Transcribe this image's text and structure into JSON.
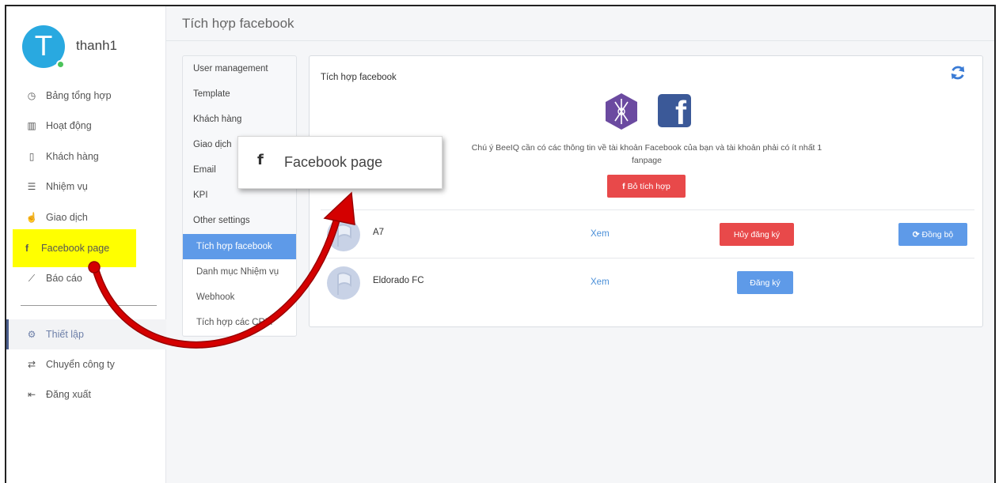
{
  "user": {
    "initial": "T",
    "name": "thanh1"
  },
  "sidebar": {
    "items": [
      {
        "label": "Bảng tổng hợp",
        "icon": "dashboard-icon"
      },
      {
        "label": "Hoạt động",
        "icon": "bar-chart-icon"
      },
      {
        "label": "Khách hàng",
        "icon": "contact-book-icon"
      },
      {
        "label": "Nhiệm vụ",
        "icon": "task-list-icon"
      },
      {
        "label": "Giao dịch",
        "icon": "hand-icon"
      },
      {
        "label": "Facebook page",
        "icon": "facebook-icon"
      },
      {
        "label": "Báo cáo",
        "icon": "line-chart-icon"
      },
      {
        "label": "Thiết lập",
        "icon": "gear-icon"
      },
      {
        "label": "Chuyển công ty",
        "icon": "swap-icon"
      },
      {
        "label": "Đăng xuất",
        "icon": "logout-icon"
      }
    ]
  },
  "header": {
    "title": "Tích hợp facebook"
  },
  "settings_menu": {
    "items": [
      "User management",
      "Template",
      "Khách hàng",
      "Giao dịch",
      "Email",
      "KPI",
      "Other settings"
    ],
    "sub_items": [
      "Tích hợp facebook",
      "Danh mục Nhiệm vụ",
      "Webhook",
      "Tích hợp các CRM"
    ]
  },
  "card": {
    "title": "Tích hợp facebook",
    "notice": "Chú ý BeeIQ cần có các thông tin về tài khoản Facebook của bạn và tài khoản phải có ít nhất 1 fanpage",
    "unlink_label": "Bỏ tích hợp",
    "fb_glyph": "f",
    "pages": [
      {
        "name": "A7",
        "view": "Xem",
        "action": "Hủy đăng ký",
        "sync": "Đồng bộ"
      },
      {
        "name": "Eldorado FC",
        "view": "Xem",
        "action": "Đăng ký"
      }
    ]
  },
  "popup": {
    "icon": "f",
    "label": "Facebook page"
  },
  "colors": {
    "accent_blue": "#5e9ae8",
    "danger_red": "#e8494a",
    "avatar_blue": "#29a9e0",
    "highlight_yellow": "#ffff00",
    "arrow_red": "#d40000",
    "facebook_blue": "#3b5998",
    "beeiq_purple": "#6b4aa0"
  }
}
